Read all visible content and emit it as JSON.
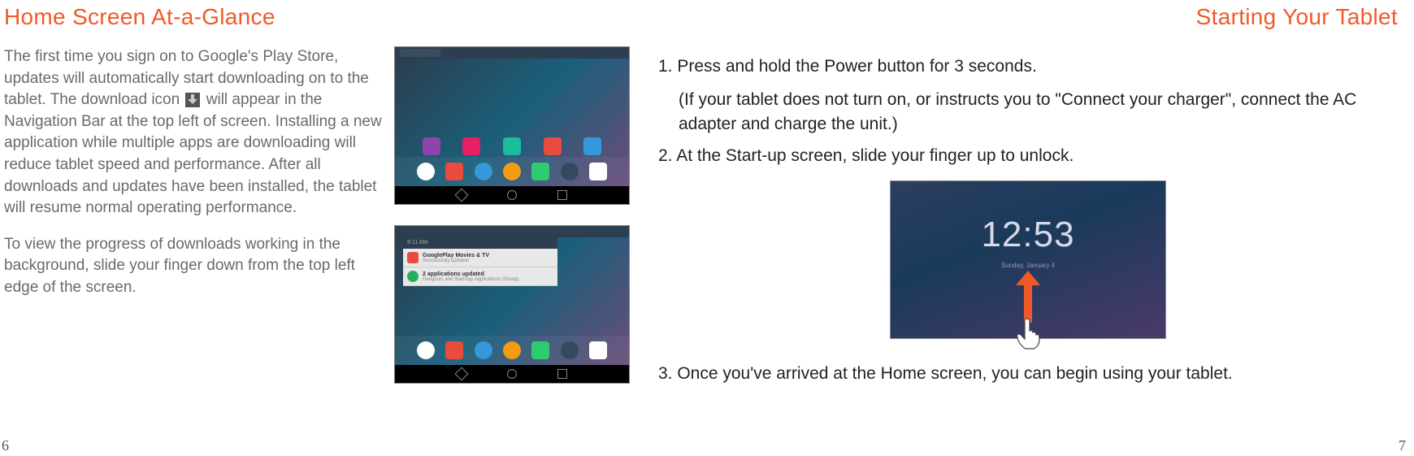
{
  "left": {
    "heading": "Home Screen At-a-Glance",
    "para1a": "The first time you sign on to Google's Play Store, updates will automatically start downloading on to the tablet. The download icon ",
    "para1b": " will appear in the Navigation Bar at the top left of screen.  Installing a new application while multiple apps are downloading will reduce tablet speed and performance.  After all downloads and updates have been installed, the tablet will resume normal operating performance.",
    "para2": "To view the progress of downloads working in the background, slide your finger down from the top left edge of the screen.",
    "page_num": "6",
    "notif": {
      "time_header": "9:11 AM",
      "row1_title": "GooglePlay Movies & TV",
      "row1_sub": "Successfully updated",
      "row2_title": "2 applications updated",
      "row2_sub": "Hangouts and StartApp Applications (Group)"
    }
  },
  "right": {
    "heading": "Starting Your Tablet",
    "step1_line1": "1. Press and hold the Power button for 3 seconds.",
    "step1_line2": "(If your tablet does not turn on, or instructs you to \"Connect your charger\", connect the AC adapter and charge the unit.)",
    "step2": "2. At the Start-up screen, slide your finger up to unlock.",
    "step3": "3. Once you've arrived at the Home screen, you can begin using your tablet.",
    "lock_time": "12:53",
    "lock_date": "Sunday, January 4",
    "page_num": "7"
  }
}
